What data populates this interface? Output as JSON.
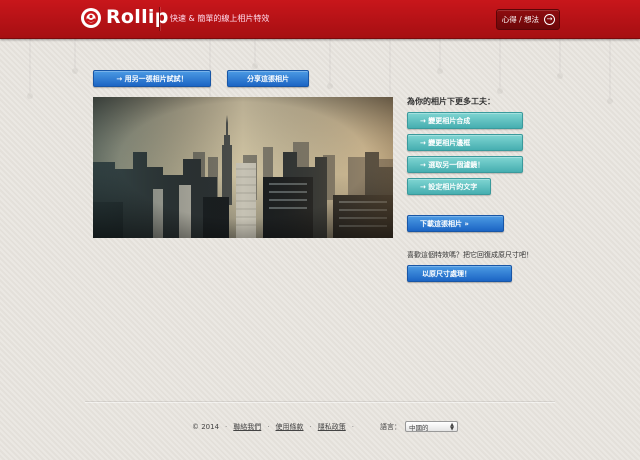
{
  "header": {
    "logo_text": "Rollip",
    "tagline": "快速 & 簡單的線上相片特效",
    "feedback_label": "心得 / 想法",
    "brand_color": "#c8161b"
  },
  "actions": {
    "try_another": "→ 用另一張相片試試！",
    "share": "分享這張相片"
  },
  "side": {
    "heading": "為你的相片下更多工夫：",
    "options": [
      "→ 變更相片合成",
      "→ 變更相片邊框",
      "→ 選取另一個濾鏡！",
      "→ 設定相片的文字"
    ],
    "download": "下載這張相片 »",
    "prompt": "喜歡這個特效嗎？把它回復成原尺寸吧！",
    "fullsize": "以原尺寸處理！"
  },
  "footer": {
    "copyright": "© 2014",
    "links": [
      "聯絡我們",
      "使用條款",
      "隱私政策"
    ],
    "lang_label": "語言：",
    "lang_value": "中國的"
  },
  "colors": {
    "blue_button": "#2a76d2",
    "teal_button": "#5cc0c0",
    "background": "#e7e3dd"
  }
}
